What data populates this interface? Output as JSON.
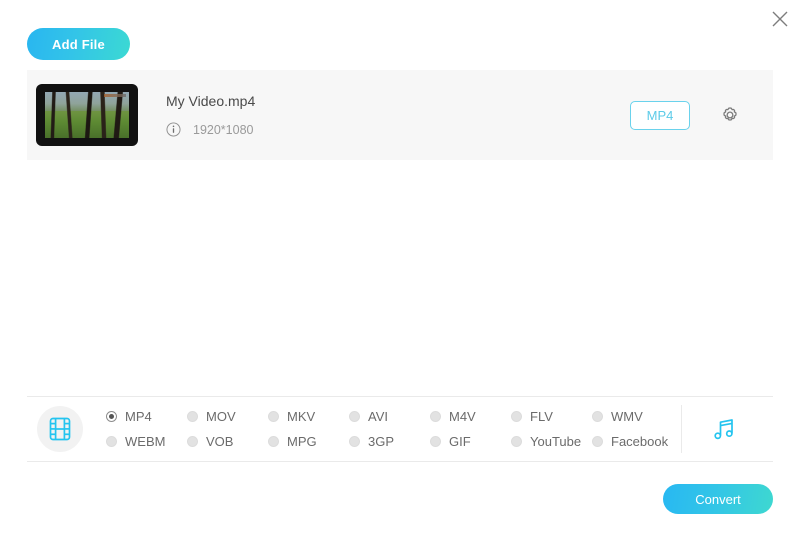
{
  "window": {
    "close_label": "✕"
  },
  "toolbar": {
    "add_file_label": "Add File"
  },
  "file": {
    "name": "My Video.mp4",
    "resolution": "1920*1080",
    "output_format_badge": "MP4"
  },
  "formats": {
    "video_options": [
      {
        "label": "MP4",
        "selected": true
      },
      {
        "label": "MOV",
        "selected": false
      },
      {
        "label": "MKV",
        "selected": false
      },
      {
        "label": "AVI",
        "selected": false
      },
      {
        "label": "M4V",
        "selected": false
      },
      {
        "label": "FLV",
        "selected": false
      },
      {
        "label": "WMV",
        "selected": false
      },
      {
        "label": "WEBM",
        "selected": false
      },
      {
        "label": "VOB",
        "selected": false
      },
      {
        "label": "MPG",
        "selected": false
      },
      {
        "label": "3GP",
        "selected": false
      },
      {
        "label": "GIF",
        "selected": false
      },
      {
        "label": "YouTube",
        "selected": false
      },
      {
        "label": "Facebook",
        "selected": false
      }
    ]
  },
  "actions": {
    "convert_label": "Convert"
  },
  "colors": {
    "accent_cyan": "#5ccbe8",
    "gradient_start": "#29b6f0",
    "gradient_end": "#3ed8d0",
    "panel_bg": "#f7f7f7",
    "border": "#eaeaea"
  }
}
